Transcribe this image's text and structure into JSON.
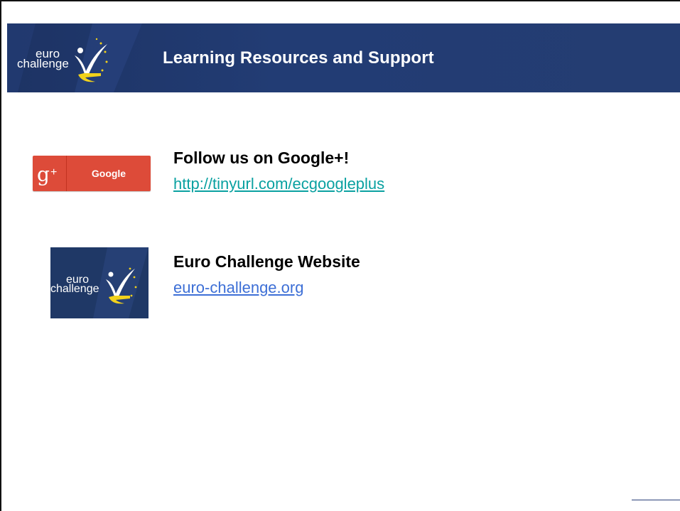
{
  "slide": {
    "title": "Learning Resources and Support",
    "logo": {
      "line1": "euro",
      "line2": "challenge"
    }
  },
  "resources": [
    {
      "badge": {
        "icon": "google-plus-icon",
        "glyph": "g",
        "plus": "+",
        "label": "Google"
      },
      "title": "Follow us on Google+!",
      "link": "http://tinyurl.com/ecgoogleplus"
    },
    {
      "title": "Euro Challenge Website",
      "link": "euro-challenge.org"
    }
  ],
  "colors": {
    "banner": "#223c74",
    "google_red": "#dd4b39",
    "link_teal": "#0aa1a1",
    "link_blue": "#3d6fd6",
    "logo_yellow": "#f2d21b"
  }
}
